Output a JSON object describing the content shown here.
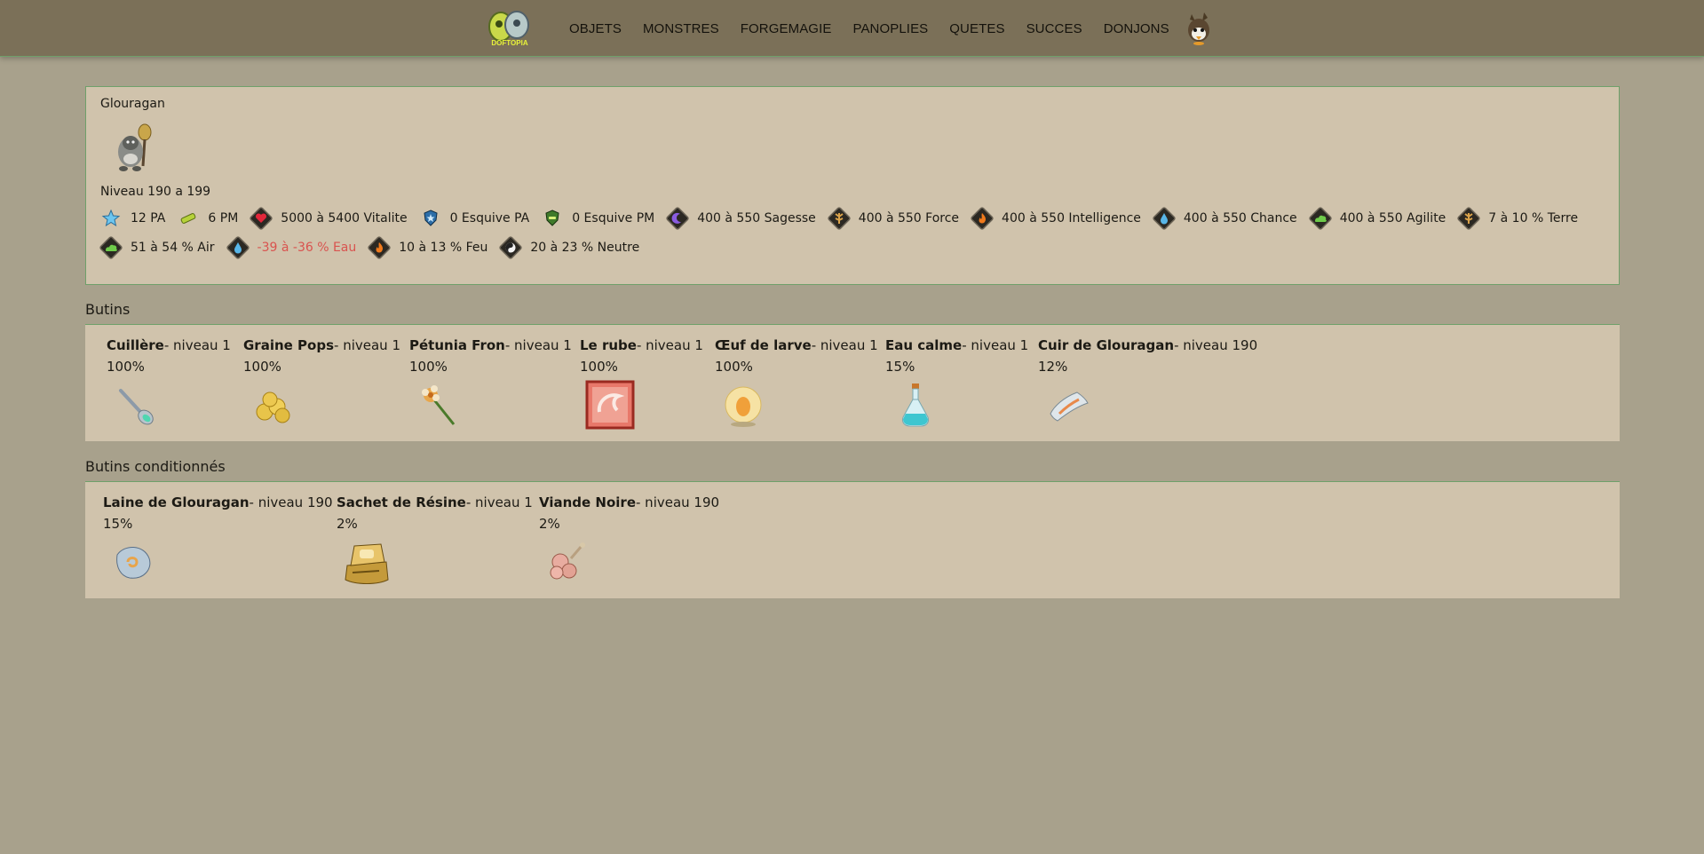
{
  "nav": {
    "logo_text": "DOFTOPIA",
    "links": [
      "OBJETS",
      "MONSTRES",
      "FORGEMAGIE",
      "PANOPLIES",
      "QUETES",
      "SUCCES",
      "DONJONS"
    ]
  },
  "monster": {
    "name": "Glouragan",
    "level": "Niveau 190 a 199",
    "stats_row1": [
      {
        "icon": "star-icon",
        "text": "12 PA"
      },
      {
        "icon": "pm-icon",
        "text": "6 PM"
      },
      {
        "icon": "heart-icon",
        "text": "5000 à 5400 Vitalite"
      },
      {
        "icon": "shield-blue-icon",
        "text": "0 Esquive PA"
      },
      {
        "icon": "shield-green-icon",
        "text": "0 Esquive PM"
      },
      {
        "icon": "wisdom-icon",
        "text": "400 à 550 Sagesse"
      },
      {
        "icon": "earth-icon",
        "text": "400 à 550 Force"
      },
      {
        "icon": "fire-icon",
        "text": "400 à 550 Intelligence"
      },
      {
        "icon": "water-icon",
        "text": "400 à 550 Chance"
      },
      {
        "icon": "air-icon",
        "text": "400 à 550 Agilite"
      },
      {
        "icon": "earth-icon",
        "text": "7 à 10 % Terre"
      }
    ],
    "stats_row2": [
      {
        "icon": "air-icon",
        "text": "51 à 54 % Air"
      },
      {
        "icon": "water-icon",
        "text": "-39 à -36 % Eau",
        "negative": true
      },
      {
        "icon": "fire-icon",
        "text": "10 à 13 % Feu"
      },
      {
        "icon": "neutral-icon",
        "text": "20 à 23 % Neutre"
      }
    ]
  },
  "drops": {
    "title": "Butins",
    "items": [
      {
        "name": "Cuillère",
        "level": "- niveau 1",
        "rate": "100%",
        "icon": "spoon-icon"
      },
      {
        "name": "Graine Pops",
        "level": "- niveau 1",
        "rate": "100%",
        "icon": "seeds-icon"
      },
      {
        "name": "Pétunia Fron",
        "level": "- niveau 1",
        "rate": "100%",
        "icon": "flower-icon"
      },
      {
        "name": "Le rube",
        "level": "- niveau 1",
        "rate": "100%",
        "icon": "rune-icon"
      },
      {
        "name": "Œuf de larve",
        "level": "- niveau 1",
        "rate": "100%",
        "icon": "egg-icon"
      },
      {
        "name": "Eau calme",
        "level": "- niveau 1",
        "rate": "15%",
        "icon": "potion-icon"
      },
      {
        "name": "Cuir de Glouragan",
        "level": "- niveau 190",
        "rate": "12%",
        "icon": "leather-icon"
      }
    ]
  },
  "conditional_drops": {
    "title": "Butins conditionnés",
    "items": [
      {
        "name": "Laine de Glouragan",
        "level": "- niveau 190",
        "rate": "15%",
        "icon": "wool-icon"
      },
      {
        "name": "Sachet de Résine",
        "level": "- niveau 1",
        "rate": "2%",
        "icon": "resin-icon"
      },
      {
        "name": "Viande Noire",
        "level": "- niveau 190",
        "rate": "2%",
        "icon": "meat-icon"
      }
    ]
  }
}
